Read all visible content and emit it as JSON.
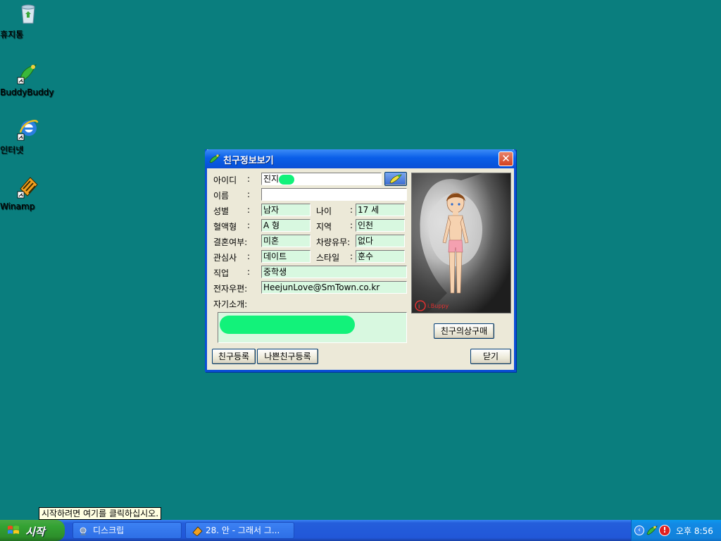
{
  "desktop": {
    "icons": [
      {
        "label": "휴지통"
      },
      {
        "label": "BuddyBuddy"
      },
      {
        "label": "인터넷"
      },
      {
        "label": "Winamp"
      }
    ]
  },
  "dialog": {
    "title": "친구정보보기",
    "close_label": "✕",
    "fields": {
      "id_label": "아이디",
      "id_value": "진지",
      "name_label": "이름",
      "name_value": "",
      "gender_label": "성별",
      "gender_value": "남자",
      "age_label": "나이",
      "age_value": "17 세",
      "blood_label": "혈액형",
      "blood_value": "A 형",
      "region_label": "지역",
      "region_value": "인천",
      "married_label": "결혼여부:",
      "married_value": "미혼",
      "car_label": "차량유무:",
      "car_value": "없다",
      "interest_label": "관심사",
      "interest_value": "데이트",
      "style_label": "스타일",
      "style_value": "훈수",
      "job_label": "직업",
      "job_value": "중학생",
      "email_label": "전자우편:",
      "email_value": "HeejunLove@SmTown.co.kr",
      "intro_label": "자기소개:"
    },
    "colon": ":",
    "buttons": {
      "add_friend": "친구등록",
      "add_bad_friend": "나쁜친구등록",
      "buy_outfit": "친구의상구매",
      "close": "닫기"
    },
    "photo_watermark": "i.Buppy"
  },
  "taskbar": {
    "start_label": "시작",
    "tooltip": "시작하려면 여기를 클릭하십시오.",
    "tasks": [
      {
        "label": "디스크립"
      },
      {
        "label": "28. 안 - 그래서 그..."
      }
    ],
    "clock": "오후 8:56"
  },
  "colors": {
    "desktop_bg": "#0a7e7e",
    "field_bg": "#d8f8e0",
    "redaction": "#12f27a",
    "title_blue": "#0a5ee8"
  }
}
